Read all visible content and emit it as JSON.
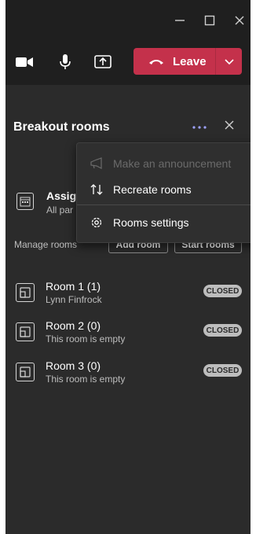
{
  "leave_button": {
    "label": "Leave"
  },
  "panel": {
    "title": "Breakout rooms"
  },
  "assign": {
    "title": "Assign",
    "subtitle": "All par"
  },
  "manage": {
    "label": "Manage rooms",
    "add_room": "Add room",
    "start_rooms": "Start rooms"
  },
  "rooms": [
    {
      "name": "Room 1 (1)",
      "sub": "Lynn Finfrock",
      "status": "CLOSED"
    },
    {
      "name": "Room 2 (0)",
      "sub": "This room is empty",
      "status": "CLOSED"
    },
    {
      "name": "Room 3 (0)",
      "sub": "This room is empty",
      "status": "CLOSED"
    }
  ],
  "menu": {
    "items": [
      {
        "label": "Make an announcement",
        "icon": "megaphone-icon",
        "disabled": true
      },
      {
        "label": "Recreate rooms",
        "icon": "recreate-arrows-icon",
        "disabled": false
      },
      {
        "label": "Rooms settings",
        "icon": "gear-icon",
        "disabled": false
      }
    ]
  },
  "colors": {
    "leave_red": "#c4314b",
    "accent": "#9ea2ff",
    "panel_bg": "#2b2b2b",
    "toolbar_bg": "#1f1f1f"
  }
}
